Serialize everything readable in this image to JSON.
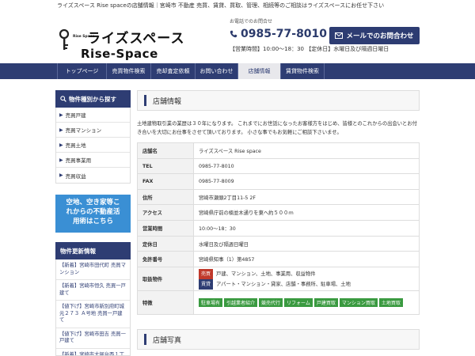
{
  "topstrip": "ライズスペース Rise spaceの店舗情報｜宮崎市 不動産 売買、賃貸、買取、管理、相続等のご相談はライズスペースにお任せ下さい",
  "logo": {
    "small_text": "Rise Space",
    "jp": "ライズスペース",
    "en": "Rise-Space"
  },
  "contact": {
    "label": "お電話でのお問合せ",
    "tel": "0985-77-8010",
    "hours": "【営業時間】10:00～18：30 【定休日】水曜日及び隔週日曜日"
  },
  "mail_button": "メールでのお問合わせ",
  "nav": [
    {
      "label": "トップページ",
      "w": 62
    },
    {
      "label": "売買物件検索",
      "w": 56
    },
    {
      "label": "売却査定依頼",
      "w": 56
    },
    {
      "label": "お問い合わせ",
      "w": 54
    },
    {
      "label": "店舗情報",
      "w": 54
    },
    {
      "label": "賃貸物件検索",
      "w": 56
    }
  ],
  "sidebar": {
    "title": "物件種別から探す",
    "items": [
      "売買戸建",
      "売買マンション",
      "売買土地",
      "売買事業用",
      "売買収益"
    ]
  },
  "banner": {
    "line1": "空地、空き家等こ",
    "line2": "れからの不動産活",
    "line3": "用術はこちら"
  },
  "updates": {
    "title": "物件更新情報",
    "items": [
      "【新着】宮崎市田代町 売買マンション",
      "【新着】宮崎市恒久 売買一戸建て",
      "【値下げ】宮崎市新別府町城元２７３ Ａ号地 売買一戸建て",
      "【値下げ】宮崎市田吉 売買一戸建て",
      "【新着】宮崎市大塚台西１丁目３２－３ 土地 売買"
    ]
  },
  "section1": {
    "title": "店舗情報"
  },
  "intro": "土地建物取引業の業歴は３０年になります。 これまでにお世話になったお客様方をはじめ、皆様とのこれからの出会いとお付き合いを大切にお仕事をさせて頂いております。 小さな事でもお気軽にご相談下さいませ。",
  "info": {
    "rows": [
      {
        "k": "店舗名",
        "v": "ライズスペース Rise space"
      },
      {
        "k": "TEL",
        "v": "0985-77-8010"
      },
      {
        "k": "FAX",
        "v": "0985-77-8009"
      },
      {
        "k": "住所",
        "v": "宮崎市瀬頭2丁目11-5 2F"
      },
      {
        "k": "アクセス",
        "v": "宮崎県庁前の楠並木通りを東へ約５００ｍ"
      },
      {
        "k": "営業時間",
        "v": "10:00～18：30"
      },
      {
        "k": "定休日",
        "v": "水曜日及び隔週日曜日"
      },
      {
        "k": "免許番号",
        "v": "宮崎県知事（1）第4857"
      }
    ],
    "handling_label": "取扱物件",
    "handling": [
      {
        "tag": "売買",
        "text": "戸建、マンション、土地、事業用、収益物件"
      },
      {
        "tag": "賃貸",
        "text": "アパート・マンション・貸家、店舗・事務所、駐車場、土地"
      }
    ],
    "features_label": "特徴",
    "features": [
      "駐車場有",
      "引越業者紹介",
      "競売代行",
      "リフォーム",
      "戸建買取",
      "マンション買取",
      "土地買取"
    ]
  },
  "section2": {
    "title": "店舗写真"
  }
}
